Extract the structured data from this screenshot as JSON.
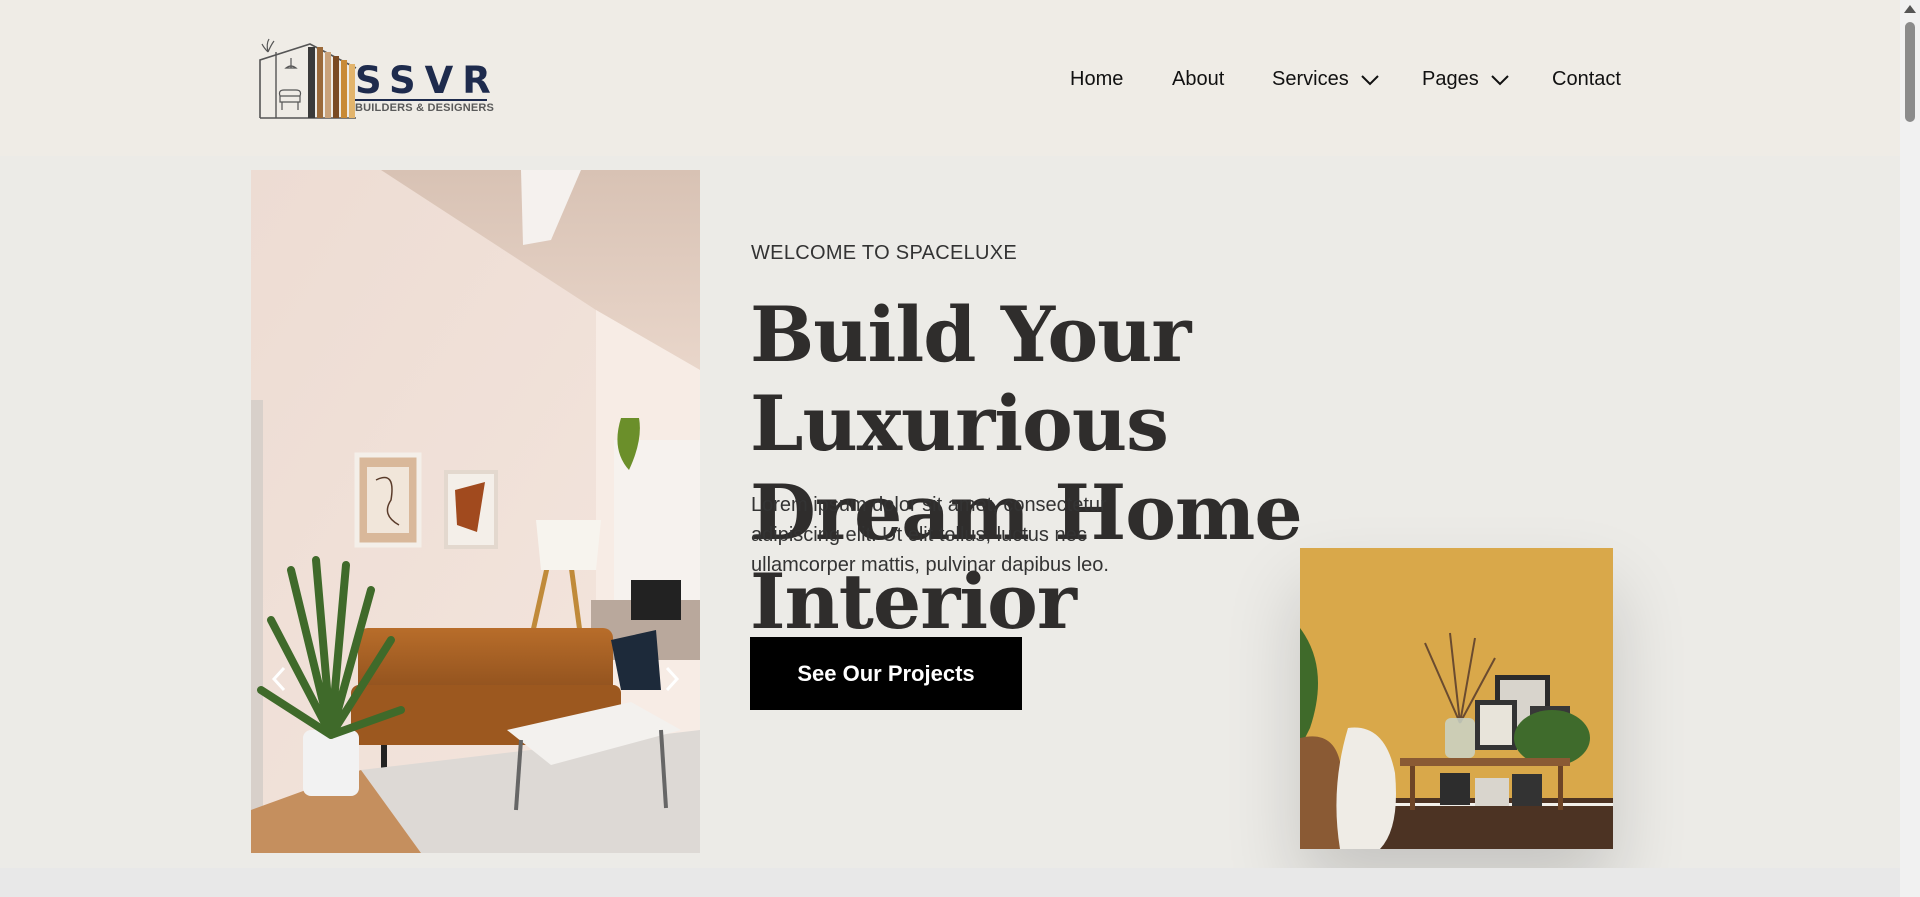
{
  "brand": {
    "name": "SSVR",
    "tagline": "BUILDERS & DESIGNERS"
  },
  "nav": {
    "items": [
      {
        "label": "Home"
      },
      {
        "label": "About"
      },
      {
        "label": "Services",
        "icon": "chevron-down-icon"
      },
      {
        "label": "Pages",
        "icon": "chevron-down-icon"
      },
      {
        "label": "Contact"
      }
    ]
  },
  "hero": {
    "eyebrow": "WELCOME TO SPACELUXE",
    "headline_line1": "Build Your Luxurious",
    "headline_line2": "Dream Home Interior",
    "body": "Lorem ipsum dolor sit amet, consectetur adipiscing elit. Ut elit tellus, luctus nec ullamcorper mattis, pulvinar dapibus leo.",
    "cta_label": "See Our Projects",
    "slider_prev_icon": "chevron-left-icon",
    "slider_next_icon": "chevron-right-icon"
  },
  "colors": {
    "header_bg": "#efece6",
    "page_bg": "#ecebe7",
    "cta_bg": "#000000",
    "brand_navy": "#1e2b4d",
    "headline": "#2f2d2c"
  }
}
